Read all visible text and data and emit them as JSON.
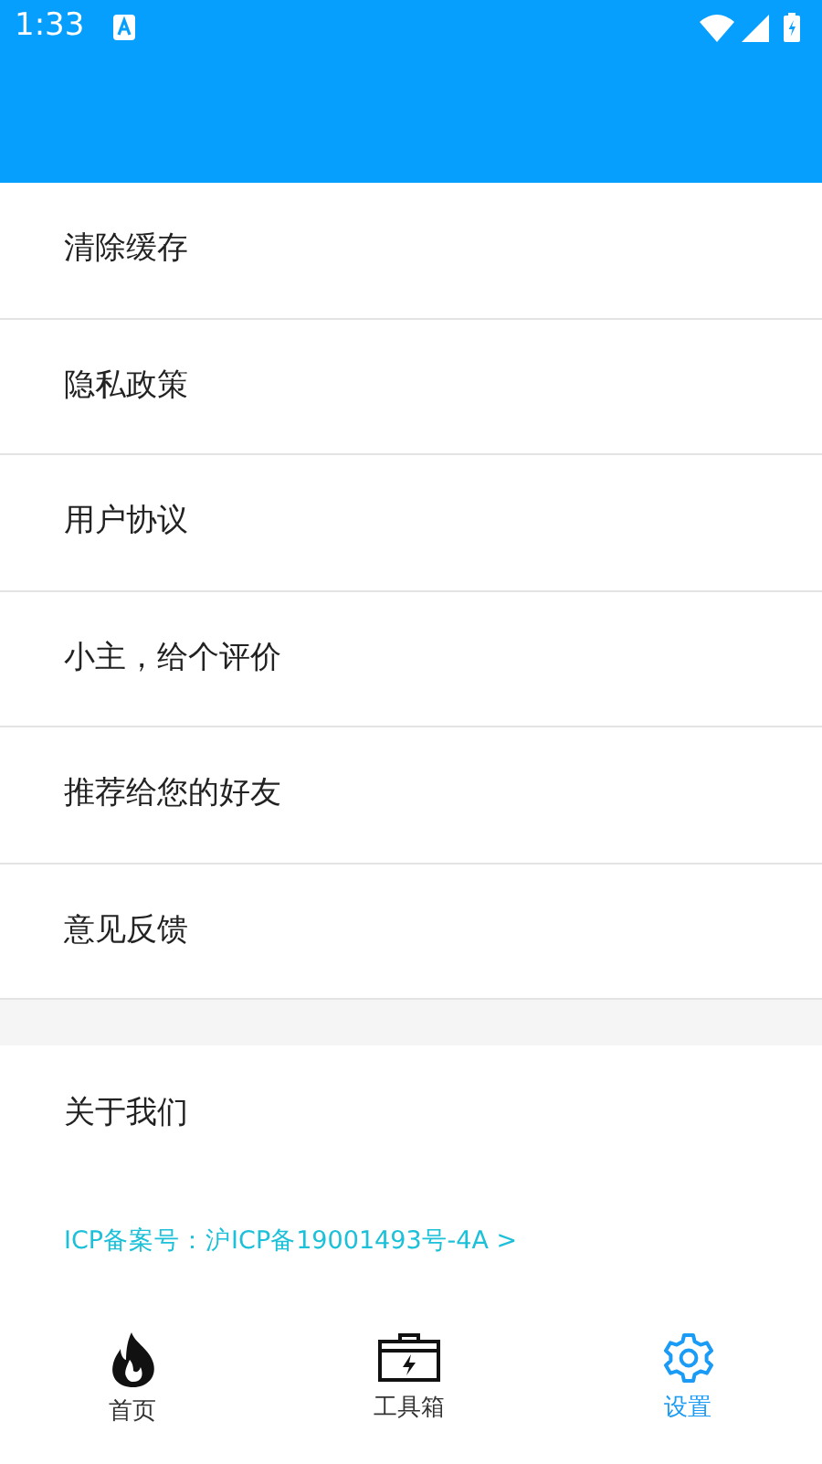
{
  "status_bar": {
    "time": "1:33"
  },
  "menu_items": [
    {
      "label": "清除缓存"
    },
    {
      "label": "隐私政策"
    },
    {
      "label": "用户协议"
    },
    {
      "label": "小主，给个评价"
    },
    {
      "label": "推荐给您的好友"
    },
    {
      "label": "意见反馈"
    }
  ],
  "about_item": {
    "label": "关于我们"
  },
  "icp_link": "ICP备案号：沪ICP备19001493号-4A >",
  "bottom_nav": [
    {
      "label": "首页",
      "kind": "flame",
      "selected": false
    },
    {
      "label": "工具箱",
      "kind": "toolbox",
      "selected": false
    },
    {
      "label": "设置",
      "kind": "gear",
      "selected": true
    }
  ]
}
